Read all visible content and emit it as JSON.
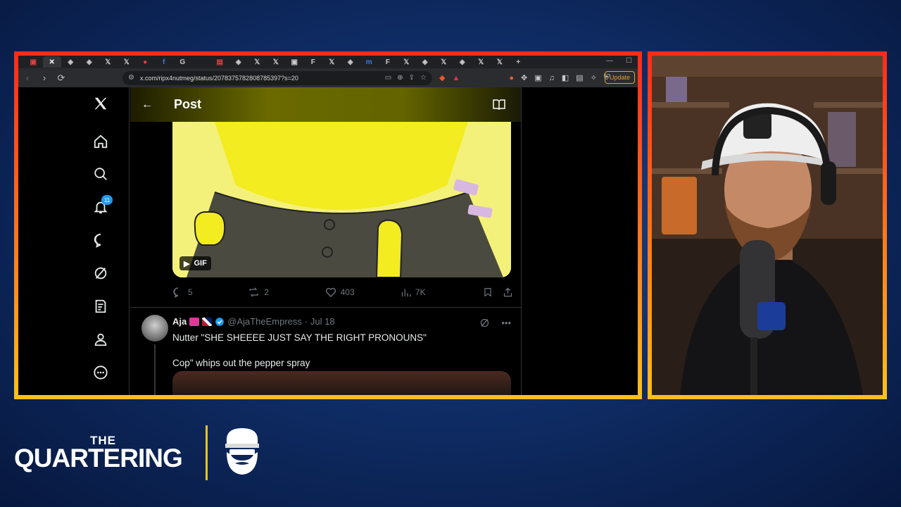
{
  "browser": {
    "tabs": [
      {
        "glyph": "▣",
        "style": "red"
      },
      {
        "glyph": "✕",
        "style": "active"
      },
      {
        "glyph": "◈",
        "style": ""
      },
      {
        "glyph": "◈",
        "style": ""
      },
      {
        "glyph": "𝕏",
        "style": ""
      },
      {
        "glyph": "𝕏",
        "style": ""
      },
      {
        "glyph": "●",
        "style": "red"
      },
      {
        "glyph": "f",
        "style": "blue"
      },
      {
        "glyph": "G",
        "style": ""
      },
      {
        "glyph": "",
        "style": ""
      },
      {
        "glyph": "▤",
        "style": "red"
      },
      {
        "glyph": "◈",
        "style": ""
      },
      {
        "glyph": "𝕏",
        "style": ""
      },
      {
        "glyph": "𝕏",
        "style": ""
      },
      {
        "glyph": "▣",
        "style": ""
      },
      {
        "glyph": "F",
        "style": ""
      },
      {
        "glyph": "𝕏",
        "style": ""
      },
      {
        "glyph": "◈",
        "style": ""
      },
      {
        "glyph": "m",
        "style": "blue"
      },
      {
        "glyph": "F",
        "style": ""
      },
      {
        "glyph": "𝕏",
        "style": ""
      },
      {
        "glyph": "◈",
        "style": ""
      },
      {
        "glyph": "𝕏",
        "style": ""
      },
      {
        "glyph": "◈",
        "style": ""
      },
      {
        "glyph": "𝕏",
        "style": ""
      },
      {
        "glyph": "𝕏",
        "style": ""
      },
      {
        "glyph": "+",
        "style": ""
      }
    ],
    "url": "x.com/ripx4nutmeg/status/2078375782808785397?s=20",
    "update_label": "Update"
  },
  "x": {
    "notification_count": "11",
    "post_header_title": "Post",
    "gif_label": "GIF",
    "actions": {
      "replies": "5",
      "reposts": "2",
      "likes": "403",
      "views": "7K"
    },
    "reply": {
      "name": "Aja",
      "handle": "@AjaTheEmpress",
      "date": "· Jul 18",
      "line1": "Nutter \"SHE SHEEEE JUST SAY THE RIGHT PRONOUNS\"",
      "line2": "Cop\" whips out the pepper spray"
    }
  },
  "brand": {
    "top": "THE",
    "name": "QUARTERING"
  },
  "colors": {
    "frame_top": "#ff2a1a",
    "frame_bottom": "#ffc01a",
    "x_blue": "#1d9bf0",
    "gif_yellow": "#f4f17a",
    "brand_gold": "#f3c21c"
  }
}
